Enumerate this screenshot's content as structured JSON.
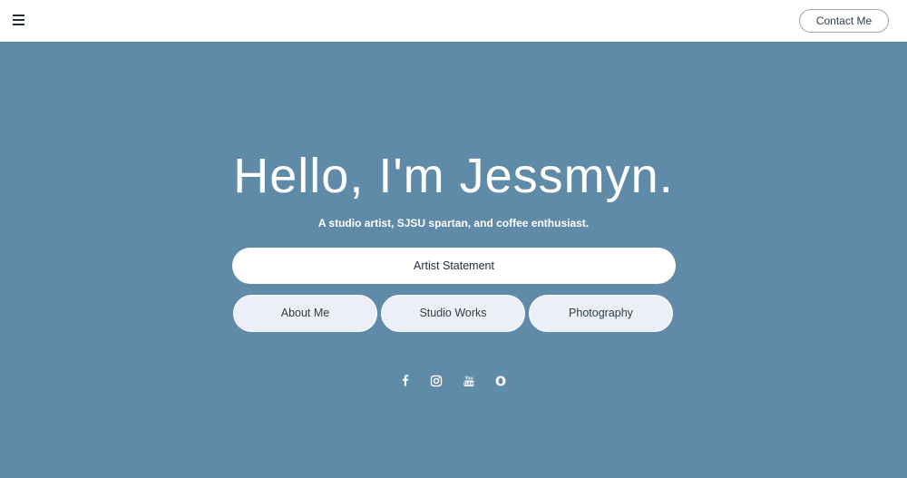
{
  "header": {
    "menu_icon": "hamburger-menu-icon",
    "contact_label": "Contact Me"
  },
  "hero": {
    "title": "Hello, I'm Jessmyn.",
    "subtitle": "A studio artist, SJSU spartan, and coffee enthusiast.",
    "primary_button": "Artist Statement",
    "buttons": [
      "About Me",
      "Studio Works",
      "Photography"
    ],
    "social_icons": [
      "facebook-icon",
      "instagram-icon",
      "youtube-icon",
      "snapchat-icon"
    ]
  },
  "colors": {
    "hero_background": "#5f8aa8",
    "topbar_background": "#ffffff",
    "pill_background": "#eceff7",
    "text_dark": "#1f2d3a"
  }
}
